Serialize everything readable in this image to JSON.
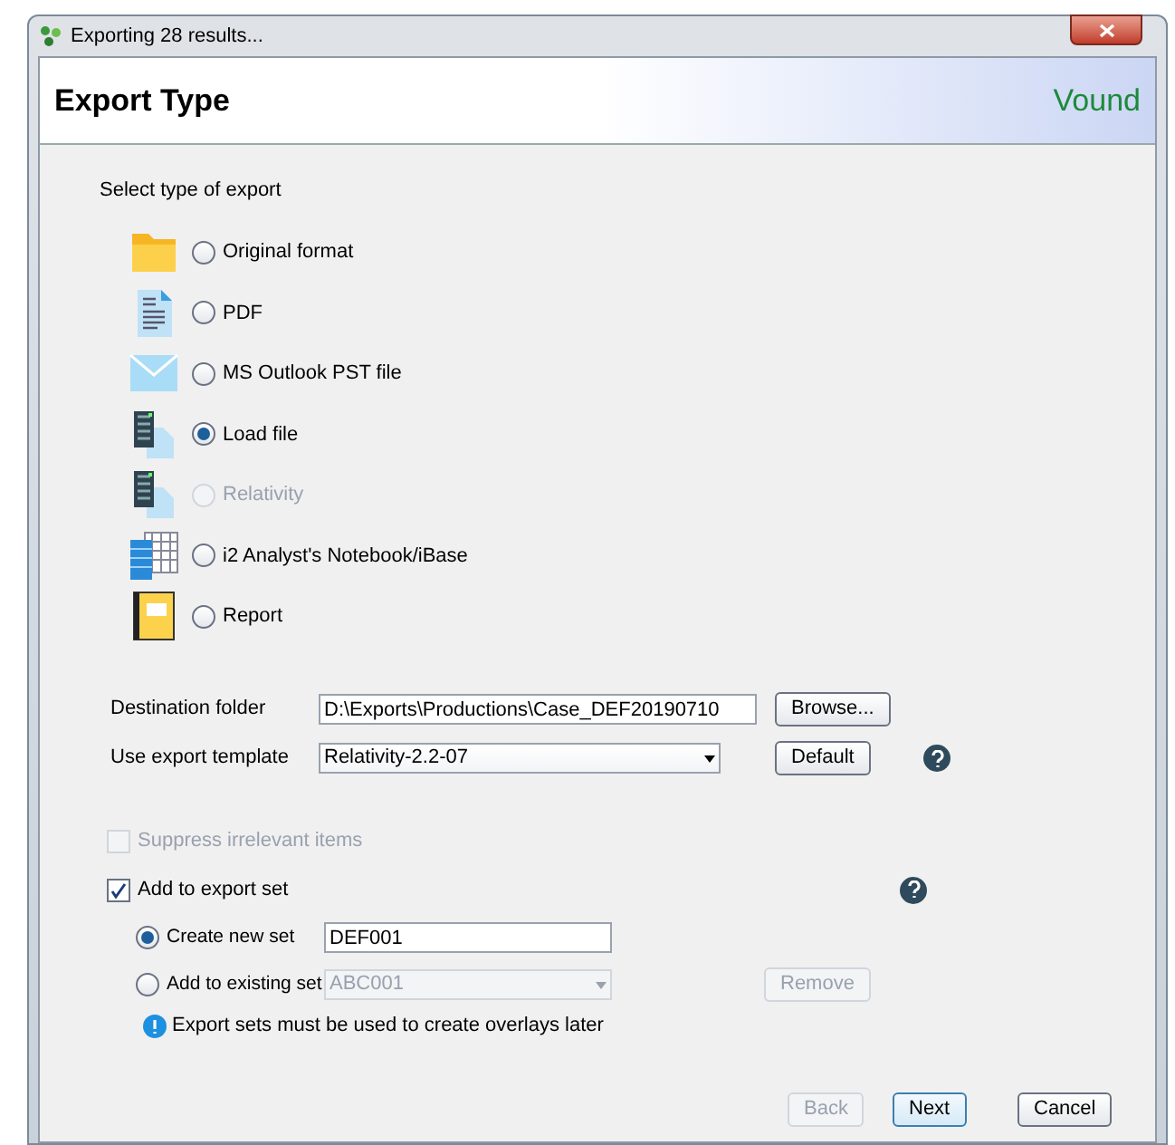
{
  "window": {
    "title": "Exporting 28 results...",
    "logo": "Vound"
  },
  "header": {
    "title": "Export Type"
  },
  "export_types": {
    "label": "Select type of export",
    "options": [
      {
        "label": "Original format",
        "kind": "folder",
        "selected": false,
        "disabled": false
      },
      {
        "label": "PDF",
        "kind": "document",
        "selected": false,
        "disabled": false
      },
      {
        "label": "MS Outlook PST file",
        "kind": "mail",
        "selected": false,
        "disabled": false
      },
      {
        "label": "Load file",
        "kind": "loadfile",
        "selected": true,
        "disabled": false
      },
      {
        "label": "Relativity",
        "kind": "loadfile",
        "selected": false,
        "disabled": true
      },
      {
        "label": "i2 Analyst's Notebook/iBase",
        "kind": "grid",
        "selected": false,
        "disabled": false
      },
      {
        "label": "Report",
        "kind": "report",
        "selected": false,
        "disabled": false
      }
    ]
  },
  "destination": {
    "label": "Destination folder",
    "value": "D:\\Exports\\Productions\\Case_DEF20190710",
    "button": "Browse..."
  },
  "template": {
    "label": "Use export template",
    "value": "Relativity-2.2-07",
    "button": "Default"
  },
  "suppress": {
    "label": "Suppress irrelevant items",
    "checked": false,
    "disabled": true
  },
  "export_set": {
    "label": "Add to export set",
    "checked": true,
    "options": [
      {
        "label": "Create new set",
        "selected": true,
        "value": "DEF001",
        "kind": "text"
      },
      {
        "label": "Add to existing set",
        "selected": false,
        "value": "ABC001",
        "kind": "select",
        "button": "Remove"
      }
    ],
    "note": "Export sets must be used to create overlays later"
  },
  "buttons": [
    {
      "label": "Back",
      "disabled": true,
      "default": false
    },
    {
      "label": "Next",
      "disabled": false,
      "default": true
    },
    {
      "label": "Cancel",
      "disabled": false,
      "default": false
    }
  ]
}
